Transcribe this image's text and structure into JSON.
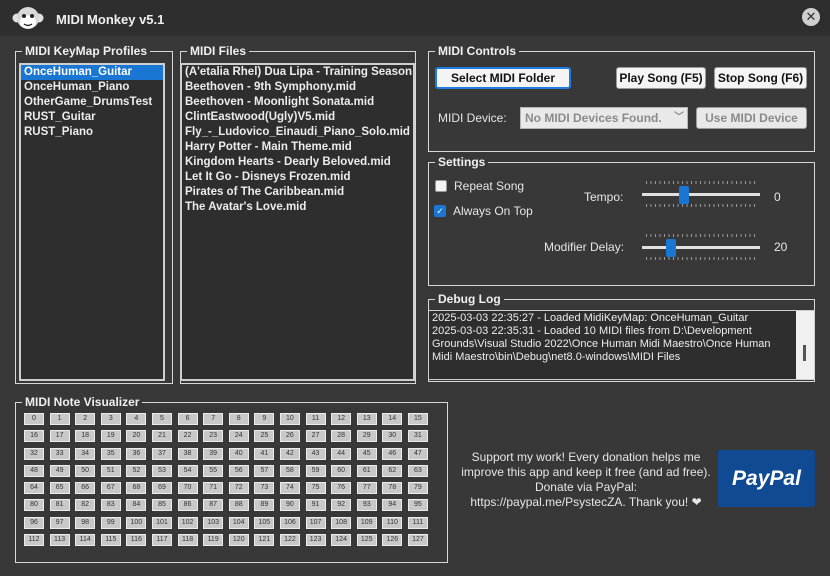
{
  "app": {
    "title": "MIDI Monkey v5.1",
    "logo_icon": "monkey-icon",
    "close_icon": "close-icon"
  },
  "profiles": {
    "title": "MIDI KeyMap Profiles",
    "items": [
      "OnceHuman_Guitar",
      "OnceHuman_Piano",
      "OtherGame_DrumsTest",
      "RUST_Guitar",
      "RUST_Piano"
    ],
    "selected": "OnceHuman_Guitar"
  },
  "files": {
    "title": "MIDI Files",
    "items": [
      "(A'etalia Rhel) Dua Lipa - Training Season",
      "Beethoven - 9th Symphony.mid",
      "Beethoven - Moonlight Sonata.mid",
      "ClintEastwood(Ugly)V5.mid",
      "Fly_-_Ludovico_Einaudi_Piano_Solo.mid",
      "Harry Potter - Main Theme.mid",
      "Kingdom Hearts - Dearly Beloved.mid",
      "Let It Go - Disneys Frozen.mid",
      "Pirates of The Caribbean.mid",
      "The Avatar's Love.mid"
    ]
  },
  "controls": {
    "title": "MIDI Controls",
    "select_folder": "Select MIDI Folder",
    "play": "Play Song (F5)",
    "stop": "Stop Song (F6)",
    "device_label": "MIDI Device:",
    "device_value": "No MIDI Devices Found.",
    "use_device": "Use MIDI Device"
  },
  "settings": {
    "title": "Settings",
    "repeat_label": "Repeat Song",
    "repeat_checked": false,
    "on_top_label": "Always On Top",
    "on_top_checked": true,
    "tempo_label": "Tempo:",
    "tempo_value": "0",
    "tempo_fraction": 0.34,
    "delay_label": "Modifier Delay:",
    "delay_value": "20",
    "delay_fraction": 0.22
  },
  "debug": {
    "title": "Debug Log",
    "lines": [
      "2025-03-03 22:35:27 - Loaded MidiKeyMap: OnceHuman_Guitar",
      "2025-03-03 22:35:31 - Loaded 10 MIDI files from D:\\Development Grounds\\Visual Studio 2022\\Once Human Midi Maestro\\Once Human Midi Maestro\\bin\\Debug\\net8.0-windows\\MIDI Files"
    ]
  },
  "visualizer": {
    "title": "MIDI Note Visualizer",
    "note_count": 128
  },
  "support": {
    "text": "Support my work! Every donation helps me improve this app and keep it free (and ad free). Donate via PayPal: https://paypal.me/PsystecZA. Thank you! ❤",
    "paypal_label": "PayPal"
  },
  "colors": {
    "accent": "#1976d2",
    "background": "#383838",
    "paypal": "#0f4a92"
  }
}
